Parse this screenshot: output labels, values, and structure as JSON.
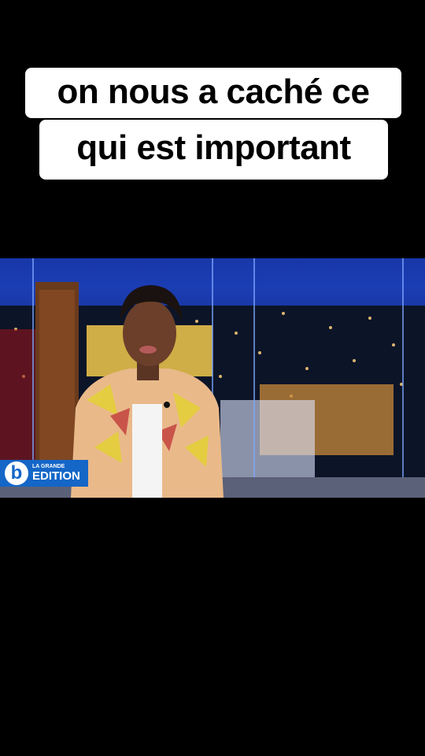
{
  "caption": {
    "line1": "on nous a caché ce",
    "line2": "qui est important"
  },
  "broadcast": {
    "logo_letter": "b",
    "program_top": "LA GRANDE",
    "program_bottom": "EDITION"
  },
  "colors": {
    "background": "#000000",
    "caption_bg": "#ffffff",
    "logo_blue": "#1466c7"
  }
}
